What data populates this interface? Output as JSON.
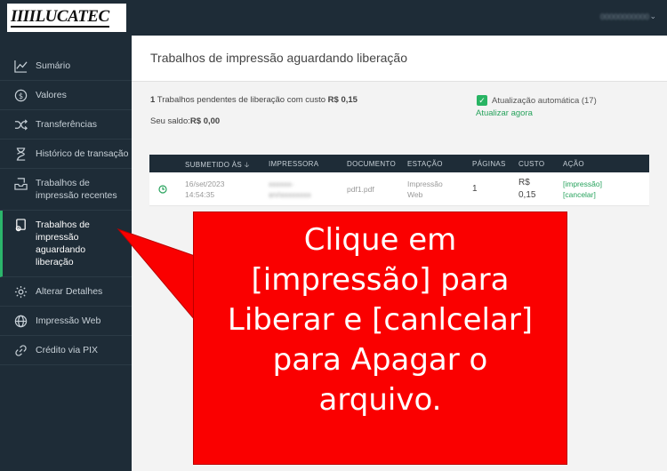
{
  "brand": {
    "logo_text": "IIIILUCATEC"
  },
  "user": {
    "name": "00000000000",
    "caret": "⌄"
  },
  "sidebar": {
    "items": [
      {
        "label": "Sumário",
        "icon": "chart-line-icon"
      },
      {
        "label": "Valores",
        "icon": "dollar-circle-icon"
      },
      {
        "label": "Transferências",
        "icon": "shuffle-icon"
      },
      {
        "label": "Histórico de transação",
        "icon": "hourglass-icon"
      },
      {
        "label": "Trabalhos de impressão recentes",
        "icon": "inbox-tray-icon"
      },
      {
        "label": "Trabalhos de impressão aguardando liberação",
        "icon": "print-queue-icon",
        "active": true
      },
      {
        "label": "Alterar Detalhes",
        "icon": "gear-icon"
      },
      {
        "label": "Impressão Web",
        "icon": "globe-icon"
      },
      {
        "label": "Crédito via PIX",
        "icon": "link-icon"
      }
    ]
  },
  "page": {
    "title": "Trabalhos de impressão aguardando liberação",
    "pending_count": "1",
    "pending_text": "Trabalhos pendentes de liberação com custo",
    "pending_cost": "R$ 0,15",
    "balance_label": "Seu saldo:",
    "balance_value": "R$ 0,00",
    "auto_refresh_label": "Atualização automática (17)",
    "auto_refresh_checked": true,
    "refresh_now": "Atualizar agora"
  },
  "table": {
    "headers": {
      "submitted": "SUBMETIDO ÀS",
      "printer": "IMPRESSORA",
      "document": "DOCUMENTO",
      "station": "ESTAÇÃO",
      "pages": "PÁGINAS",
      "cost": "CUSTO",
      "action": "AÇÃO"
    },
    "rows": [
      {
        "date": "16/set/2023",
        "time": "14:54:35",
        "printer_line1": "xxxxxx-",
        "printer_line2": "srv\\xxxxxxxx",
        "document": "pdf1.pdf",
        "station_line1": "Impressão",
        "station_line2": "Web",
        "pages": "1",
        "cost_line1": "R$",
        "cost_line2": "0,15",
        "release": "[impressão]",
        "cancel": "[cancelar]"
      }
    ]
  },
  "overlay": {
    "color": "#fa0000",
    "lines": [
      "Clique  em",
      "[impressão] para",
      "Liberar e [canlcelar]",
      "para Apagar o",
      "arquivo."
    ]
  },
  "colors": {
    "sidebar": "#1e2c37",
    "accent": "#28a35d"
  }
}
